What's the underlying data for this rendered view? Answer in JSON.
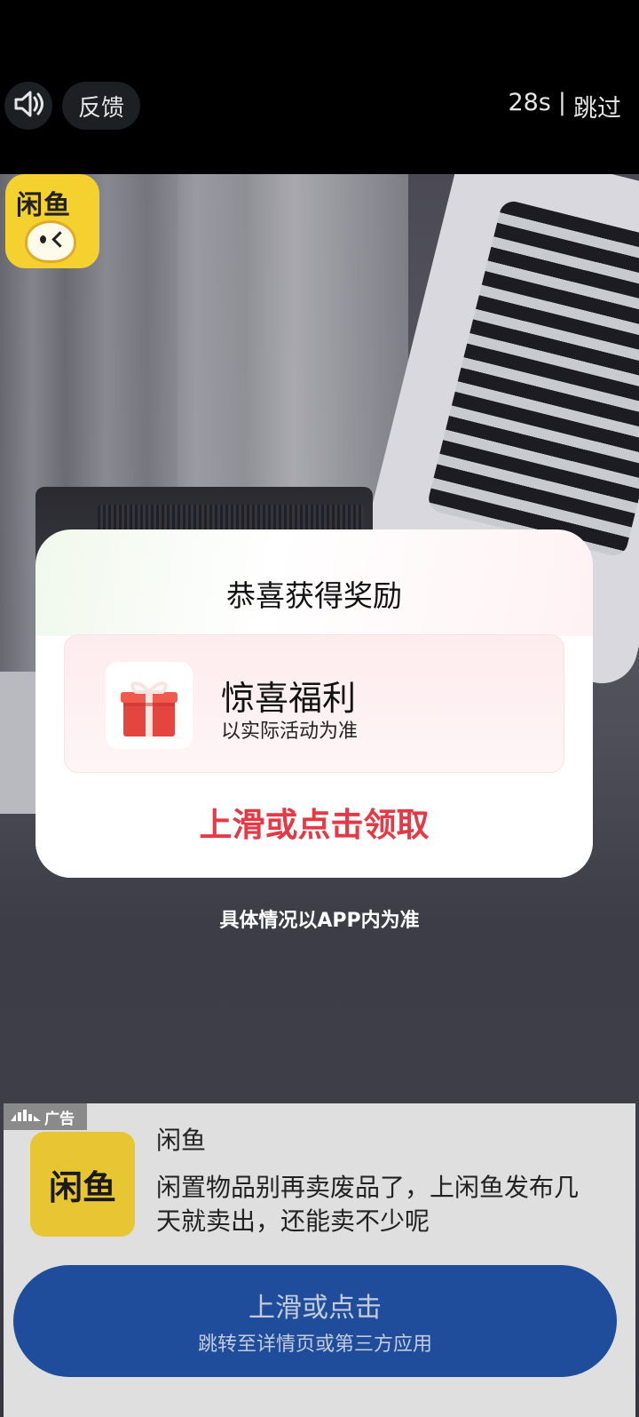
{
  "top_bar": {
    "sound_icon": "speaker-volume-icon",
    "feedback_label": "反馈",
    "countdown": "28s",
    "separator": "|",
    "skip_label": "跳过"
  },
  "corner_logo": {
    "brand_text": "闲鱼"
  },
  "reward_card": {
    "title": "恭喜获得奖励",
    "gift_icon": "gift-box-icon",
    "gift_name": "惊喜福利",
    "gift_note": "以实际活动为准",
    "claim_label": "上滑或点击领取"
  },
  "disclaimer": "具体情况以APP内为准",
  "ad": {
    "badge_icon": "signal-bars-icon",
    "badge_label": "广告",
    "logo_text": "闲鱼",
    "app_name": "闲鱼",
    "description": "闲置物品别再卖废品了，上闲鱼发布几天就卖出，还能卖不少呢",
    "cta_main": "上滑或点击",
    "cta_sub": "跳转至详情页或第三方应用"
  },
  "colors": {
    "accent_red": "#e63946",
    "cta_blue": "#1f4d9c",
    "brand_yellow": "#f4d12e"
  }
}
